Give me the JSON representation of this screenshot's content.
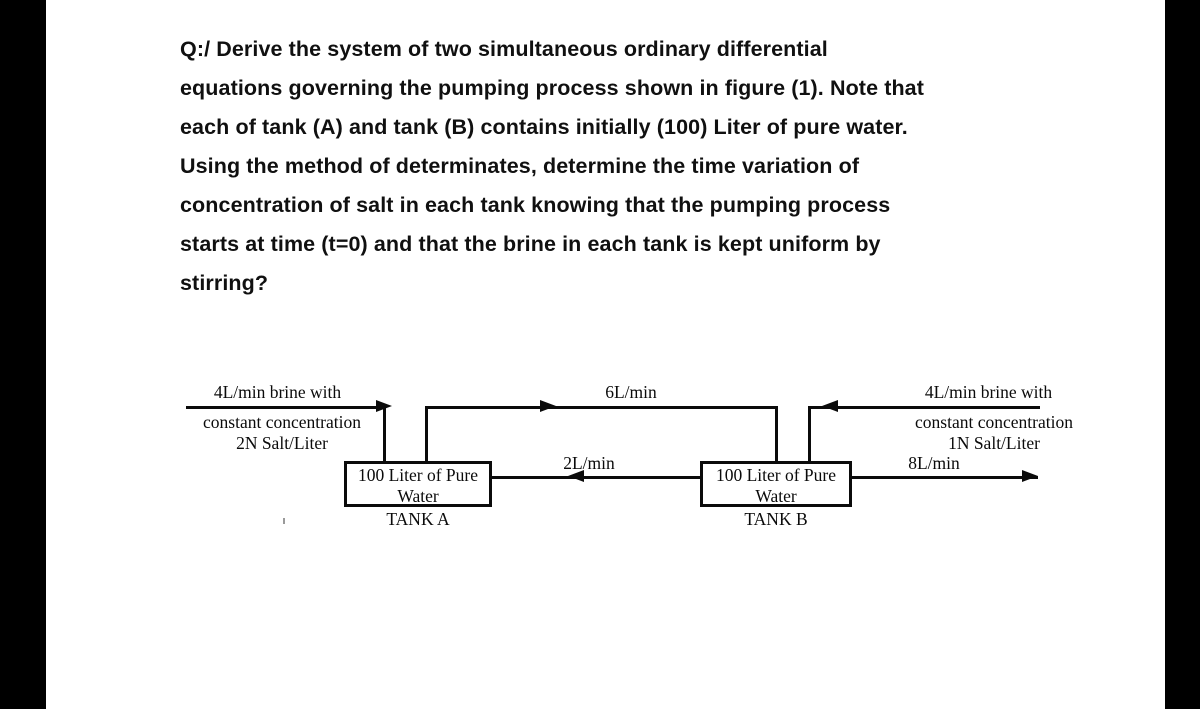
{
  "page": {
    "background_color": "#000000",
    "sheet_color": "#ffffff"
  },
  "question": {
    "lines": [
      "Q:/ Derive the system of two simultaneous ordinary differential",
      "equations governing the pumping process shown in figure (1). Note that",
      "each of tank (A) and tank (B) contains initially (100) Liter of pure water.",
      "Using the method of determinates, determine the time variation of",
      "concentration of salt in each tank knowing that the pumping process",
      "starts at time (t=0) and that the brine in each tank is kept uniform by",
      "stirring?"
    ],
    "full_text": "Q:/ Derive the system of two simultaneous ordinary differential equations governing the pumping process shown in figure (1). Note that each of tank (A) and tank (B) contains initially (100) Liter of pure water. Using the method of determinates, determine the time variation of concentration of salt in each tank knowing that the pumping process starts at time (t=0) and that the brine in each tank is kept uniform by stirring?"
  },
  "diagram": {
    "figure_reference": "figure (1)",
    "line_color": "#0b0b0b",
    "tank_a": {
      "caption": "TANK A",
      "contents_line1": "100 Liter of Pure",
      "contents_line2": "Water",
      "initial_volume": "100 Liter",
      "initial_contents": "Pure Water"
    },
    "tank_b": {
      "caption": "TANK B",
      "contents_line1": "100 Liter of Pure",
      "contents_line2": "Water",
      "initial_volume": "100 Liter",
      "initial_contents": "Pure Water"
    },
    "inflow_left": {
      "line1": "4L/min brine with",
      "line2": "constant concentration",
      "line3": "2N Salt/Liter",
      "rate": "4L/min",
      "concentration": "2N Salt/Liter",
      "direction": "right"
    },
    "inflow_right": {
      "line1": "4L/min brine with",
      "line2": "constant concentration",
      "line3": "1N Salt/Liter",
      "rate": "4L/min",
      "concentration": "1N Salt/Liter",
      "direction": "left"
    },
    "flow_a_to_b": {
      "label": "6L/min",
      "rate": "6L/min",
      "direction": "right"
    },
    "flow_b_to_a": {
      "label": "2L/min",
      "rate": "2L/min",
      "direction": "left"
    },
    "outflow": {
      "label": "8L/min",
      "rate": "8L/min",
      "direction": "right"
    }
  }
}
